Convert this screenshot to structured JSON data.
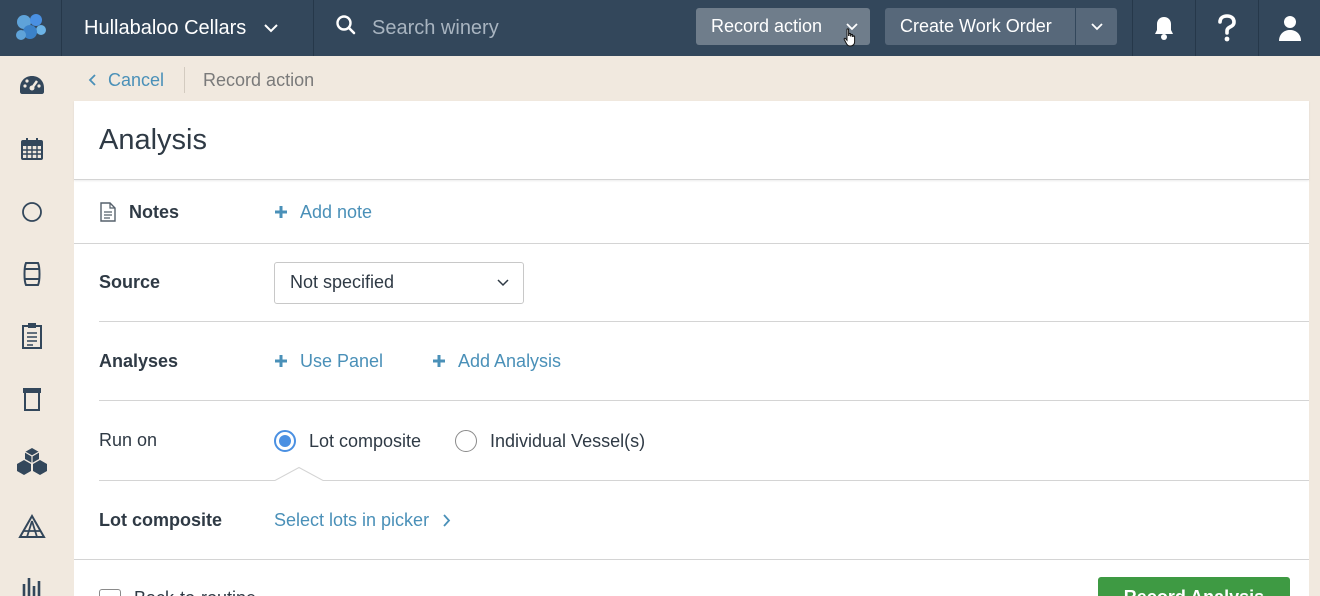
{
  "topbar": {
    "winery_name": "Hullabaloo Cellars",
    "search_placeholder": "Search winery",
    "record_action_label": "Record action",
    "create_work_order_label": "Create Work Order"
  },
  "breadcrumb": {
    "cancel_label": "Cancel",
    "current": "Record action"
  },
  "form": {
    "title": "Analysis",
    "notes": {
      "label": "Notes",
      "add_label": "Add note"
    },
    "source": {
      "label": "Source",
      "value": "Not specified"
    },
    "analyses": {
      "label": "Analyses",
      "use_panel_label": "Use Panel",
      "add_analysis_label": "Add Analysis"
    },
    "run_on": {
      "label": "Run on",
      "options": [
        "Lot composite",
        "Individual Vessel(s)"
      ],
      "selected": "Lot composite"
    },
    "lot_composite": {
      "label": "Lot composite",
      "picker_label": "Select lots in picker"
    },
    "footer": {
      "checkbox_label": "Back-to-routine",
      "submit_label": "Record Analysis"
    }
  },
  "colors": {
    "topbar_bg": "#33475b",
    "page_bg": "#f1e9df",
    "link": "#4a90b8",
    "primary_green": "#3e9a43",
    "radio_selected": "#4a90e2"
  },
  "icons": {
    "sidebar": [
      "dashboard-icon",
      "calendar-icon",
      "circle-icon",
      "barrel-icon",
      "clipboard-icon",
      "tank-icon",
      "boxes-icon",
      "vineyard-icon",
      "reports-icon"
    ],
    "topbar": [
      "bell-icon",
      "help-icon",
      "user-icon"
    ]
  }
}
